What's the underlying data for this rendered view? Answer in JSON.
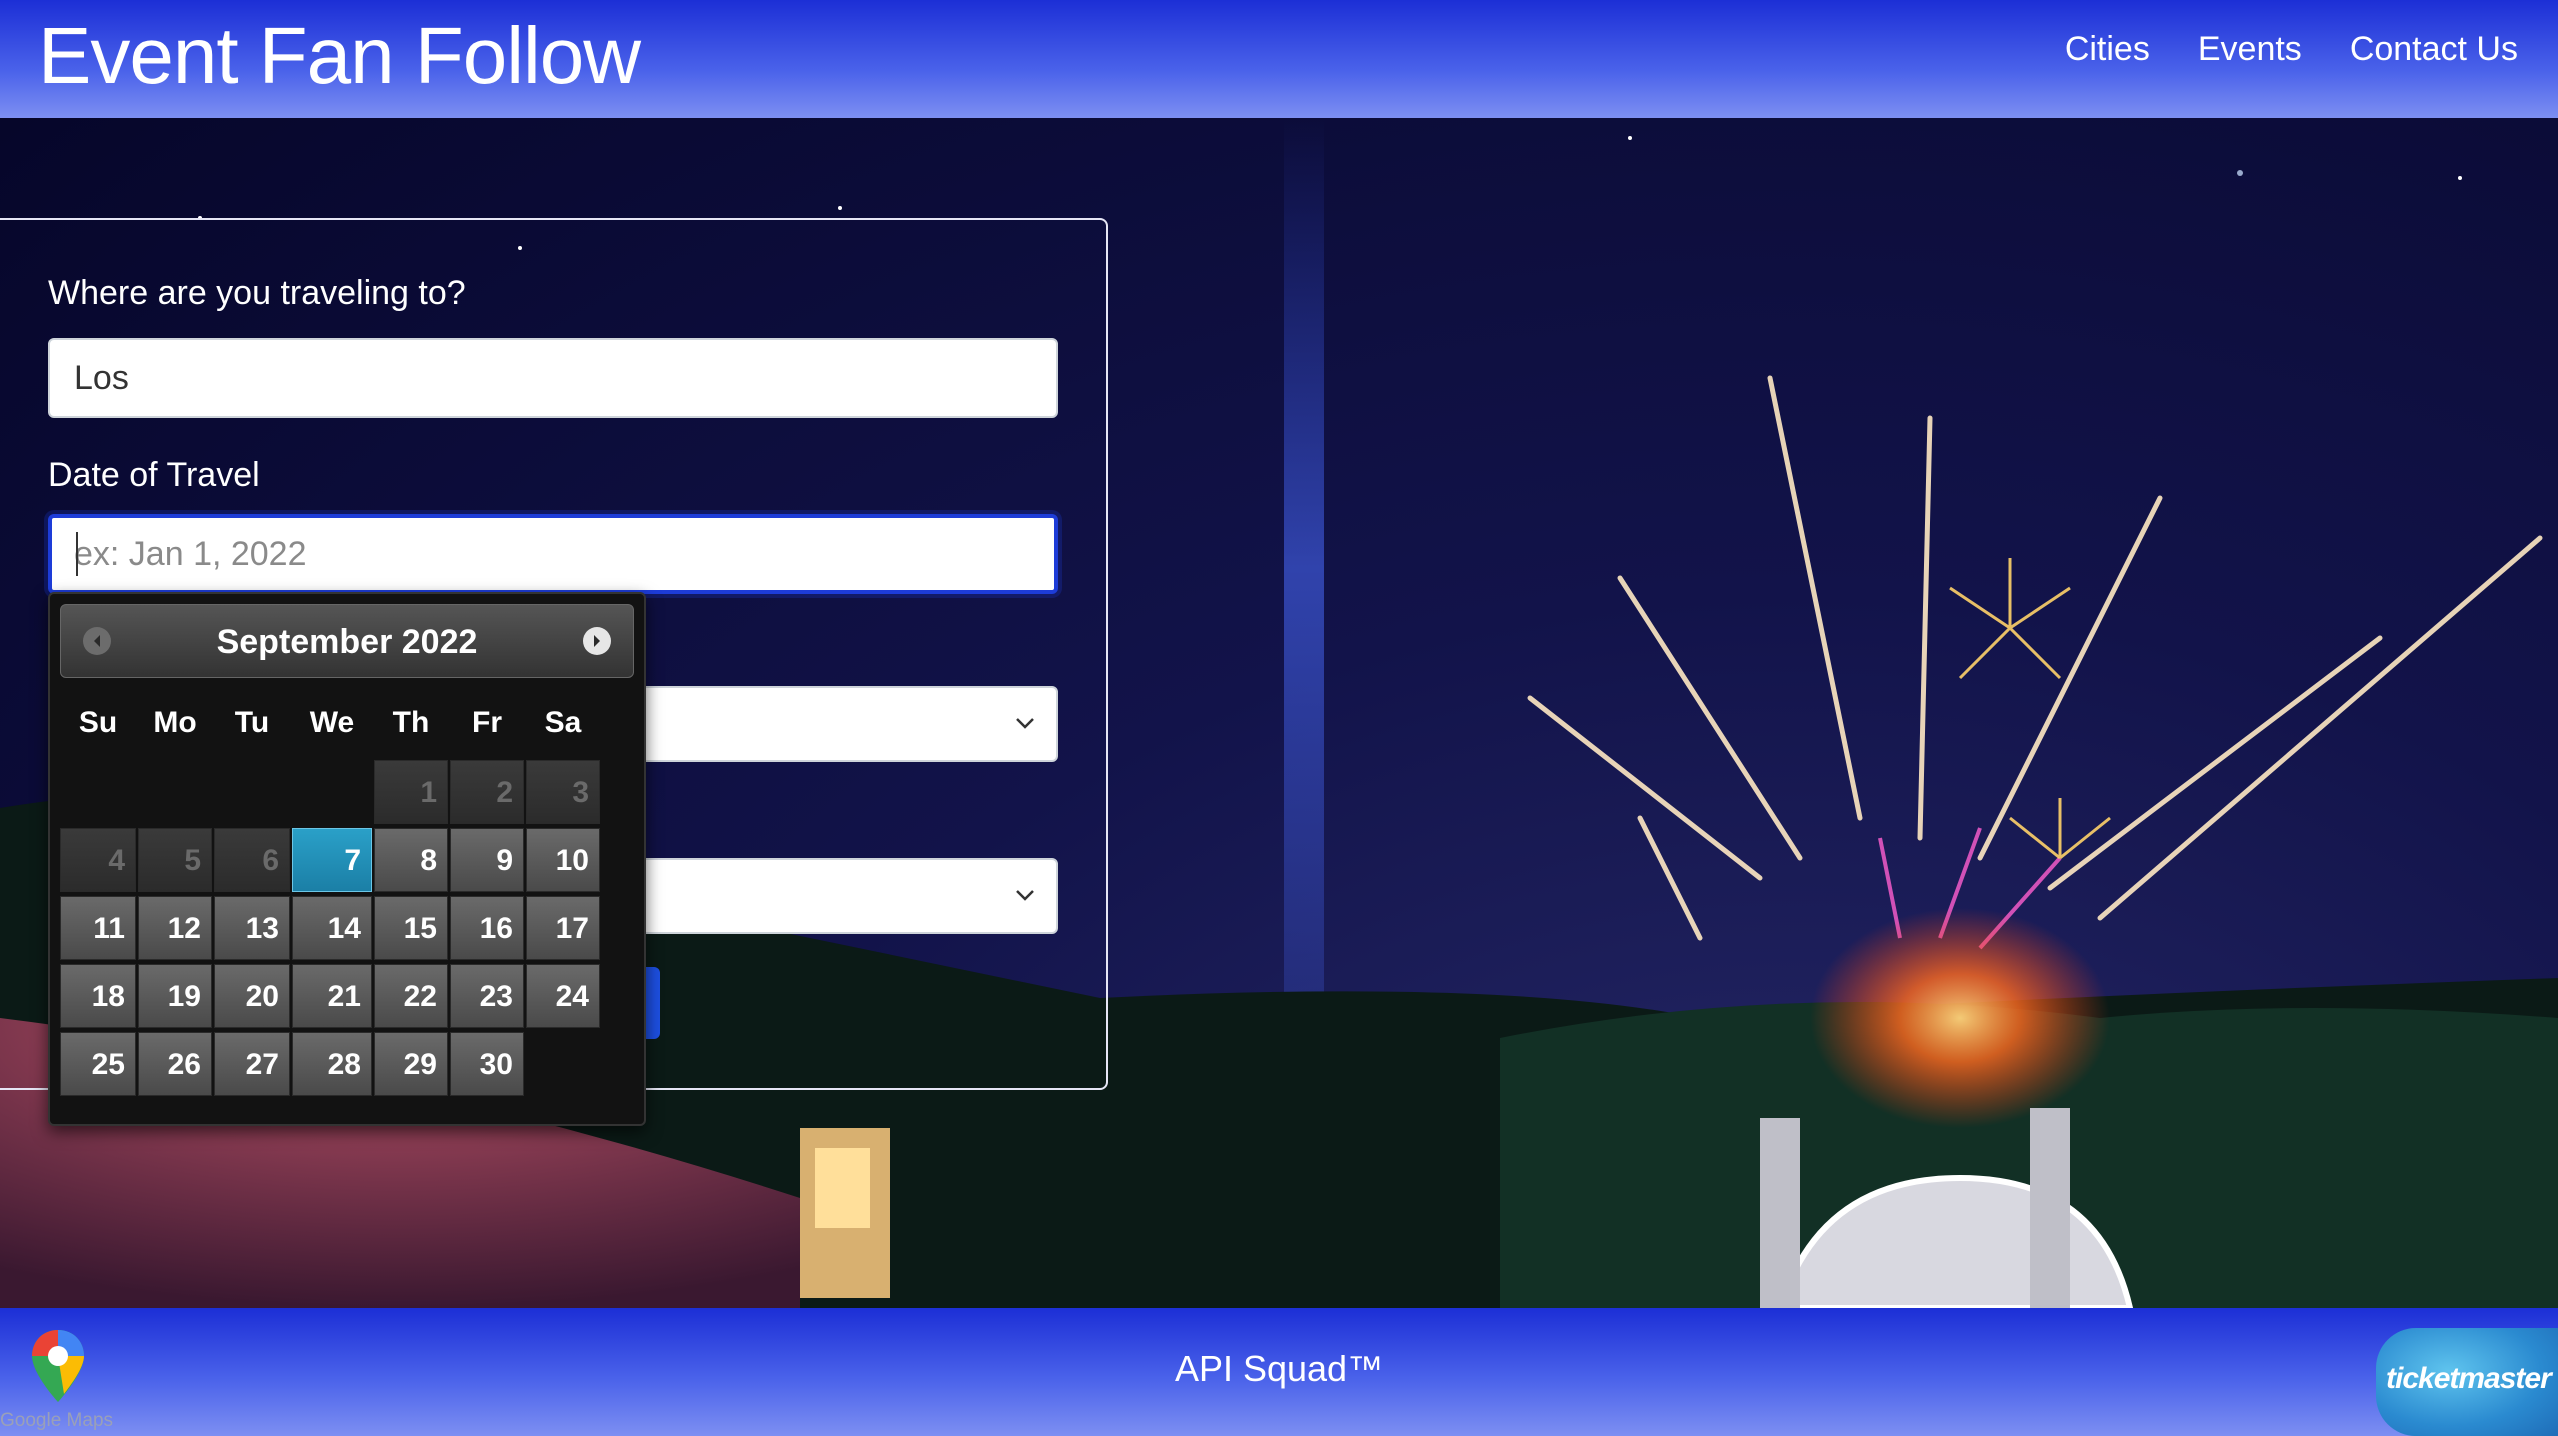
{
  "header": {
    "brand": "Event Fan Follow",
    "nav": [
      "Cities",
      "Events",
      "Contact Us"
    ]
  },
  "form": {
    "destination_label": "Where are you traveling to?",
    "destination_value": "Los",
    "date_label": "Date of Travel",
    "date_placeholder": "ex: Jan 1, 2022"
  },
  "datepicker": {
    "title": "September 2022",
    "prev_icon": "chevron-left-icon",
    "next_icon": "chevron-right-icon",
    "weekdays": [
      "Su",
      "Mo",
      "Tu",
      "We",
      "Th",
      "Fr",
      "Sa"
    ],
    "selected_day": "7",
    "rows": [
      [
        "",
        "",
        "",
        "",
        "1",
        "2",
        "3"
      ],
      [
        "4",
        "5",
        "6",
        "7",
        "8",
        "9",
        "10"
      ],
      [
        "11",
        "12",
        "13",
        "14",
        "15",
        "16",
        "17"
      ],
      [
        "18",
        "19",
        "20",
        "21",
        "22",
        "23",
        "24"
      ],
      [
        "25",
        "26",
        "27",
        "28",
        "29",
        "30",
        ""
      ]
    ],
    "disabled_days": [
      "1",
      "2",
      "3",
      "4",
      "5",
      "6"
    ]
  },
  "footer": {
    "text": "API Squad™",
    "left_logo_label": "Google Maps",
    "right_logo_label": "ticketmaster"
  },
  "colors": {
    "header_bg": "#1c2fd6",
    "accent_focus": "#1d3cd8",
    "datepicker_active": "#2aa0c8"
  }
}
